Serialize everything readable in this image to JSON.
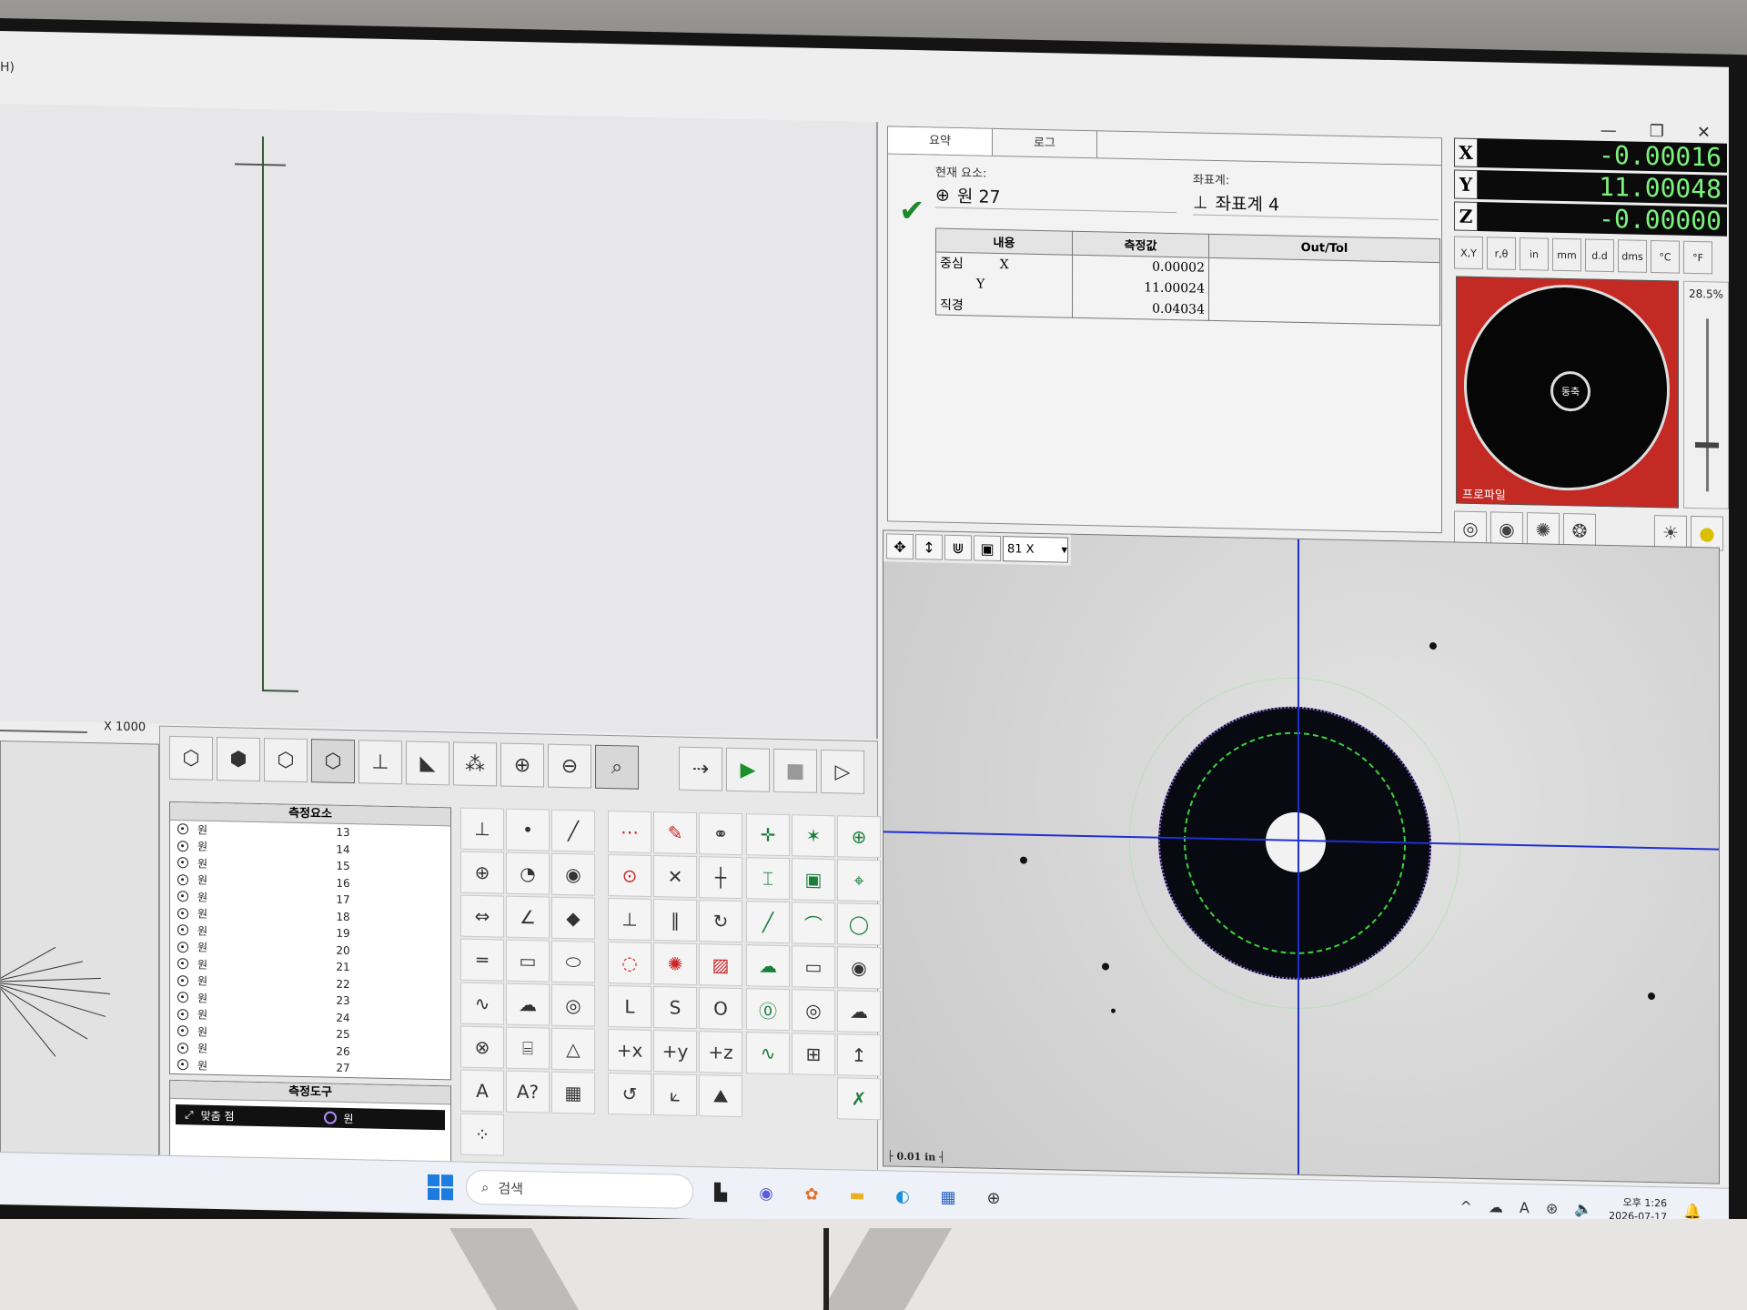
{
  "window": {
    "menu_fragment": "H)",
    "controls": {
      "minimize": "—",
      "restore": "❐",
      "close": "✕"
    }
  },
  "graph_view": {
    "scale_label": "X 1000"
  },
  "toolbar": {
    "buttons": [
      "iso-view",
      "solid-view",
      "wire-view",
      "top-view",
      "axes",
      "profile",
      "code",
      "zoom-in",
      "zoom-out",
      "zoom-fit",
      "run-sequence",
      "play",
      "stop",
      "step"
    ]
  },
  "features_panel": {
    "title": "측정요소",
    "items": [
      {
        "name": "원",
        "number": "13"
      },
      {
        "name": "원",
        "number": "14"
      },
      {
        "name": "원",
        "number": "15"
      },
      {
        "name": "원",
        "number": "16"
      },
      {
        "name": "원",
        "number": "17"
      },
      {
        "name": "원",
        "number": "18"
      },
      {
        "name": "원",
        "number": "19"
      },
      {
        "name": "원",
        "number": "20"
      },
      {
        "name": "원",
        "number": "21"
      },
      {
        "name": "원",
        "number": "22"
      },
      {
        "name": "원",
        "number": "23"
      },
      {
        "name": "원",
        "number": "24"
      },
      {
        "name": "원",
        "number": "25"
      },
      {
        "name": "원",
        "number": "26"
      },
      {
        "name": "원",
        "number": "27"
      }
    ]
  },
  "tools_panel": {
    "title": "측정도구",
    "selected_tool": "맞춤 점",
    "selected_shape": "원"
  },
  "summary": {
    "tabs": [
      "요약",
      "로그"
    ],
    "current_feature_label": "현재 요소:",
    "current_feature": "원 27",
    "coord_label": "좌표계:",
    "coord_system": "좌표계 4",
    "table": {
      "headers": [
        "내용",
        "측정값",
        "Out/Tol"
      ],
      "rows": [
        {
          "name": "중심",
          "axis": "X",
          "value": "0.00002",
          "tol": ""
        },
        {
          "name": "",
          "axis": "Y",
          "value": "11.00024",
          "tol": ""
        },
        {
          "name": "직경",
          "axis": "",
          "value": "0.04034",
          "tol": ""
        }
      ]
    }
  },
  "dro": {
    "rows": [
      {
        "axis": "X",
        "value": "-0.00016"
      },
      {
        "axis": "Y",
        "value": "11.00048"
      },
      {
        "axis": "Z",
        "value": "-0.00000"
      }
    ],
    "unit_buttons": [
      "X,Y",
      "r,θ",
      "in",
      "mm",
      "d.d",
      "dms",
      "°C",
      "°F"
    ],
    "display_color": "#7cf27c"
  },
  "profile_light": {
    "label": "프로파일",
    "knob_label": "동축",
    "percent": "28.5%",
    "bg_color": "#c42a24"
  },
  "camera": {
    "zoom": "81 X",
    "scale": "├ 0.01 in ┤"
  },
  "taskbar": {
    "search_placeholder": "검색",
    "clock_time": "오후 1:26",
    "clock_date": "2026-07-17"
  }
}
